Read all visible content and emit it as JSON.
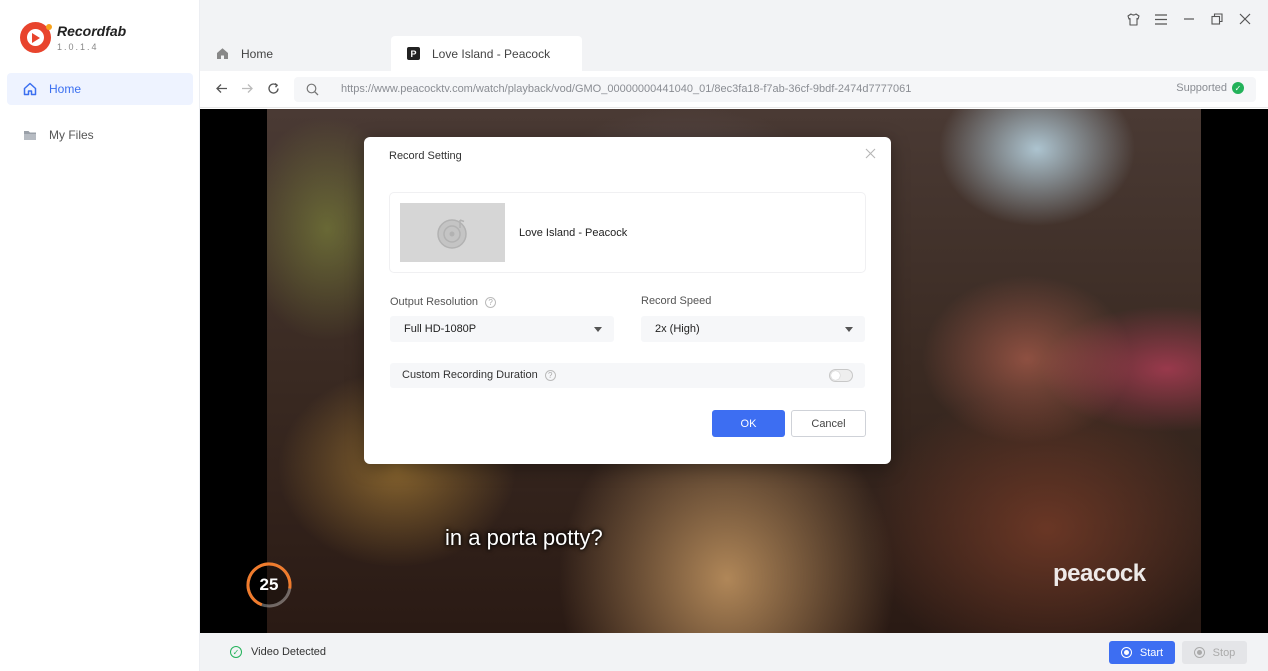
{
  "app": {
    "name": "Recordfab",
    "version": "1.0.1.4"
  },
  "sidebar": {
    "items": [
      {
        "label": "Home",
        "icon": "home-icon",
        "active": true
      },
      {
        "label": "My Files",
        "icon": "folder-icon",
        "active": false
      }
    ]
  },
  "window_controls": [
    "skin-icon",
    "menu-icon",
    "minimize-icon",
    "restore-icon",
    "close-icon"
  ],
  "tabs": [
    {
      "label": "Home",
      "icon": "home-icon",
      "active": false
    },
    {
      "label": "Love Island - Peacock",
      "icon": "peacock-favicon",
      "badge": "P",
      "active": true
    }
  ],
  "address_bar": {
    "url": "https://www.peacocktv.com/watch/playback/vod/GMO_00000000441040_01/8ec3fa18-f7ab-36cf-9bdf-2474d7777061",
    "status": "Supported"
  },
  "video": {
    "subtitle": "in a porta potty?",
    "watermark": "peacock",
    "countdown": "25"
  },
  "dialog": {
    "title": "Record Setting",
    "media_title": "Love Island - Peacock",
    "output_resolution_label": "Output Resolution",
    "output_resolution_value": "Full HD-1080P",
    "record_speed_label": "Record Speed",
    "record_speed_value": "2x (High)",
    "custom_duration_label": "Custom Recording Duration",
    "custom_duration_enabled": false,
    "ok_label": "OK",
    "cancel_label": "Cancel"
  },
  "bottom_bar": {
    "status": "Video Detected",
    "start_label": "Start",
    "stop_label": "Stop"
  },
  "colors": {
    "accent": "#3d6ef2",
    "success": "#23b25a",
    "brand": "#e8442d",
    "countdown_ring": "#f07b2c"
  }
}
